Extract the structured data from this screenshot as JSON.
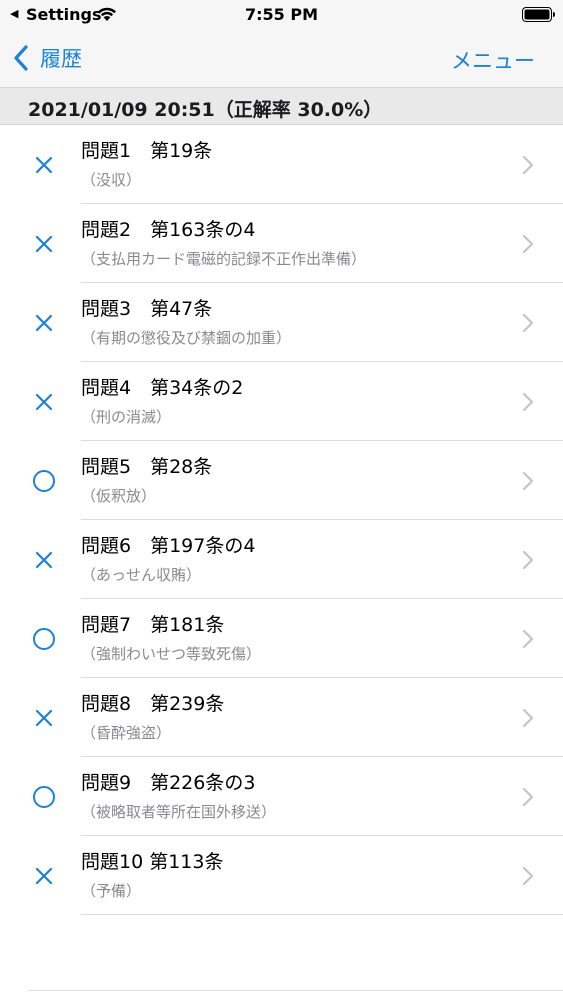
{
  "status_bar": {
    "back_arrow": "◀",
    "back_app": "Settings",
    "time": "7:55 PM"
  },
  "nav": {
    "back_label": "履歴",
    "menu_label": "メニュー"
  },
  "section": {
    "header": "2021/01/09 20:51（正解率 30.0%）"
  },
  "colors": {
    "accent": "#1a82db",
    "subtitle": "#8a8a8e",
    "chevron": "#c4c4c7"
  },
  "rows": [
    {
      "result": "wrong",
      "icon": "cross-icon",
      "title": "問題1　第19条",
      "subtitle": "（没収）"
    },
    {
      "result": "wrong",
      "icon": "cross-icon",
      "title": "問題2　第163条の4",
      "subtitle": "（支払用カード電磁的記録不正作出準備）"
    },
    {
      "result": "wrong",
      "icon": "cross-icon",
      "title": "問題3　第47条",
      "subtitle": "（有期の懲役及び禁錮の加重）"
    },
    {
      "result": "wrong",
      "icon": "cross-icon",
      "title": "問題4　第34条の2",
      "subtitle": "（刑の消滅）"
    },
    {
      "result": "correct",
      "icon": "circle-icon",
      "title": "問題5　第28条",
      "subtitle": "（仮釈放）"
    },
    {
      "result": "wrong",
      "icon": "cross-icon",
      "title": "問題6　第197条の4",
      "subtitle": "（あっせん収賄）"
    },
    {
      "result": "correct",
      "icon": "circle-icon",
      "title": "問題7　第181条",
      "subtitle": "（強制わいせつ等致死傷）"
    },
    {
      "result": "wrong",
      "icon": "cross-icon",
      "title": "問題8　第239条",
      "subtitle": "（昏酔強盗）"
    },
    {
      "result": "correct",
      "icon": "circle-icon",
      "title": "問題9　第226条の3",
      "subtitle": "（被略取者等所在国外移送）"
    },
    {
      "result": "wrong",
      "icon": "cross-icon",
      "title": "問題10 第113条",
      "subtitle": "（予備）"
    }
  ]
}
